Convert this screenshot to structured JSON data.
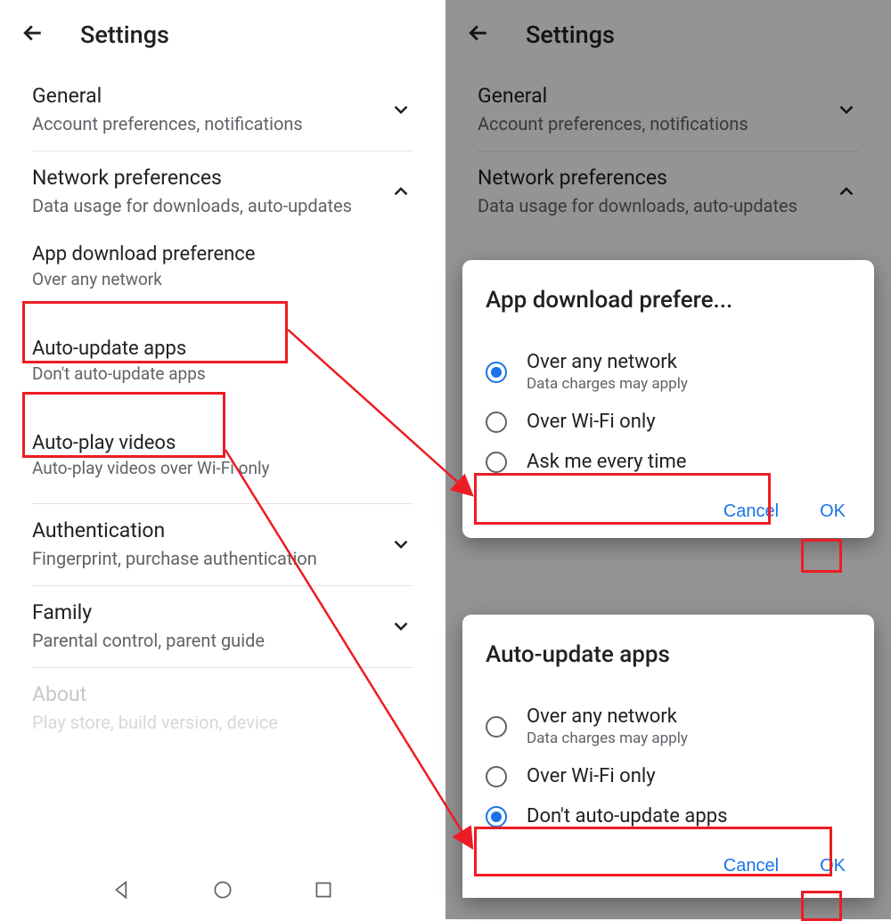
{
  "left": {
    "header": {
      "title": "Settings"
    },
    "sections": {
      "general": {
        "title": "General",
        "sub": "Account preferences, notifications"
      },
      "network": {
        "title": "Network preferences",
        "sub": "Data usage for downloads, auto-updates"
      },
      "app_dl": {
        "title": "App download preference",
        "sub": "Over any network"
      },
      "auto_upd": {
        "title": "Auto-update apps",
        "sub": "Don't auto-update apps"
      },
      "autoplay": {
        "title": "Auto-play videos",
        "sub": "Auto-play videos over Wi-Fi only"
      },
      "auth": {
        "title": "Authentication",
        "sub": "Fingerprint, purchase authentication"
      },
      "family": {
        "title": "Family",
        "sub": "Parental control, parent guide"
      },
      "about": {
        "title": "About",
        "sub": "Play store, build version, device"
      }
    }
  },
  "right": {
    "header": {
      "title": "Settings"
    },
    "dialog1": {
      "title": "App download prefere...",
      "opt1": {
        "label": "Over any network",
        "sub": "Data charges may apply"
      },
      "opt2": {
        "label": "Over Wi-Fi only"
      },
      "opt3": {
        "label": "Ask me every time"
      },
      "cancel": "Cancel",
      "ok": "OK"
    },
    "dialog2": {
      "title": "Auto-update apps",
      "opt1": {
        "label": "Over any network",
        "sub": "Data charges may apply"
      },
      "opt2": {
        "label": "Over Wi-Fi only"
      },
      "opt3": {
        "label": "Don't auto-update apps"
      },
      "cancel": "Cancel",
      "ok": "OK"
    }
  }
}
